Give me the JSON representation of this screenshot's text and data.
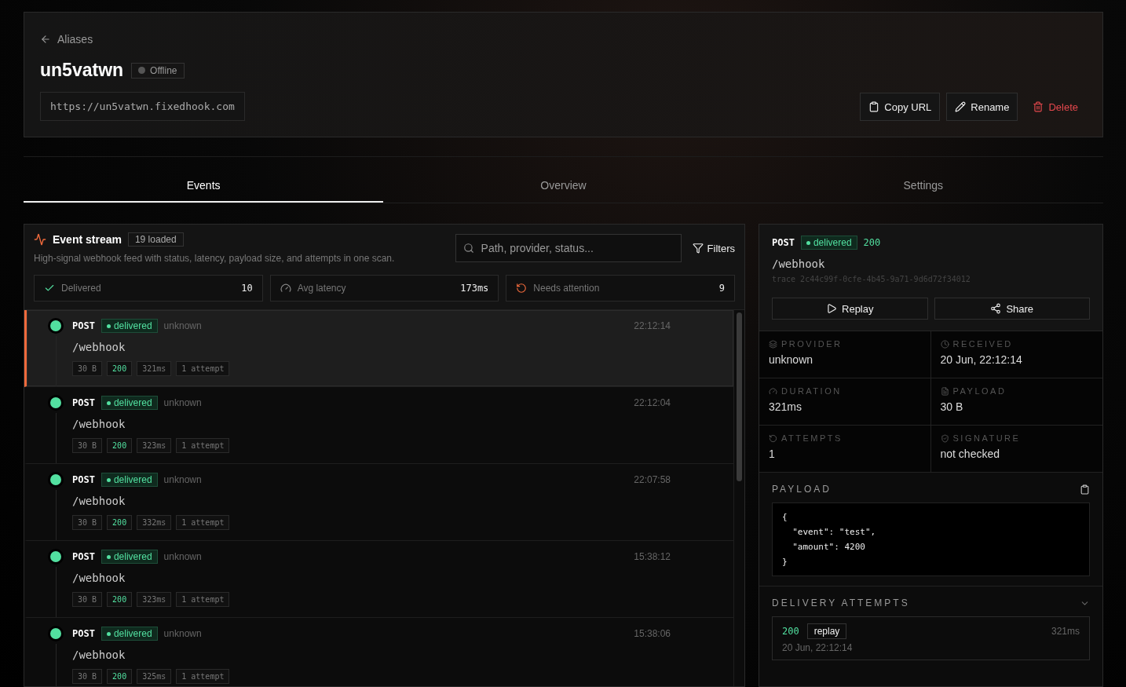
{
  "header": {
    "back_link": "Aliases",
    "title": "un5vatwn",
    "status": {
      "label": "Offline",
      "online": false
    },
    "url": "https://un5vatwn.fixedhook.com",
    "actions": [
      {
        "kind": "copy",
        "label": "Copy URL"
      },
      {
        "kind": "rename",
        "label": "Rename"
      },
      {
        "kind": "delete",
        "label": "Delete"
      }
    ]
  },
  "tabs": [
    {
      "label": "Events",
      "selected": true
    },
    {
      "label": "Overview",
      "selected": false
    },
    {
      "label": "Settings",
      "selected": false
    }
  ],
  "stream": {
    "title": "Event stream",
    "count": "19 loaded",
    "subtitle": "High-signal webhook feed with status, latency, payload size, and attempts in one scan.",
    "search": {
      "placeholder": "Path, provider, status..."
    },
    "filters_label": "Filters",
    "stats": [
      {
        "kind": "delivered",
        "label": "Delivered",
        "value": "10"
      },
      {
        "kind": "latency",
        "label": "Avg latency",
        "value": "173ms"
      },
      {
        "kind": "attention",
        "label": "Needs attention",
        "value": "9"
      }
    ],
    "events": [
      {
        "method": "POST",
        "status": "delivered",
        "provider": "unknown",
        "time": "22:12:14",
        "path": "/webhook",
        "size": "30 B",
        "code": "200",
        "duration": "321ms",
        "attempts": "1 attempt",
        "selected": true
      },
      {
        "method": "POST",
        "status": "delivered",
        "provider": "unknown",
        "time": "22:12:04",
        "path": "/webhook",
        "size": "30 B",
        "code": "200",
        "duration": "323ms",
        "attempts": "1 attempt",
        "selected": false
      },
      {
        "method": "POST",
        "status": "delivered",
        "provider": "unknown",
        "time": "22:07:58",
        "path": "/webhook",
        "size": "30 B",
        "code": "200",
        "duration": "332ms",
        "attempts": "1 attempt",
        "selected": false
      },
      {
        "method": "POST",
        "status": "delivered",
        "provider": "unknown",
        "time": "15:38:12",
        "path": "/webhook",
        "size": "30 B",
        "code": "200",
        "duration": "323ms",
        "attempts": "1 attempt",
        "selected": false
      },
      {
        "method": "POST",
        "status": "delivered",
        "provider": "unknown",
        "time": "15:38:06",
        "path": "/webhook",
        "size": "30 B",
        "code": "200",
        "duration": "325ms",
        "attempts": "1 attempt",
        "selected": false
      }
    ]
  },
  "detail": {
    "method": "POST",
    "status": "delivered",
    "code": "200",
    "path": "/webhook",
    "trace": "trace 2c44c99f-0cfe-4b45-9a71-9d6d72f34012",
    "buttons": [
      {
        "kind": "replay",
        "label": "Replay"
      },
      {
        "kind": "share",
        "label": "Share"
      }
    ],
    "fields": [
      {
        "kind": "provider",
        "label": "PROVIDER",
        "value": "unknown"
      },
      {
        "kind": "received",
        "label": "RECEIVED",
        "value": "20 Jun, 22:12:14"
      },
      {
        "kind": "duration",
        "label": "DURATION",
        "value": "321ms"
      },
      {
        "kind": "payload",
        "label": "PAYLOAD",
        "value": "30 B"
      },
      {
        "kind": "attempts",
        "label": "ATTEMPTS",
        "value": "1"
      },
      {
        "kind": "signature",
        "label": "SIGNATURE",
        "value": "not checked"
      }
    ],
    "payload": {
      "title": "PAYLOAD",
      "lines": [
        "{",
        "  \"event\": \"test\",",
        "  \"amount\": 4200",
        "}"
      ]
    },
    "attempts": {
      "title": "DELIVERY ATTEMPTS",
      "expanded": true,
      "items": [
        {
          "code": "200",
          "tag": "replay",
          "duration": "321ms",
          "time": "20 Jun, 22:12:14"
        }
      ]
    }
  }
}
